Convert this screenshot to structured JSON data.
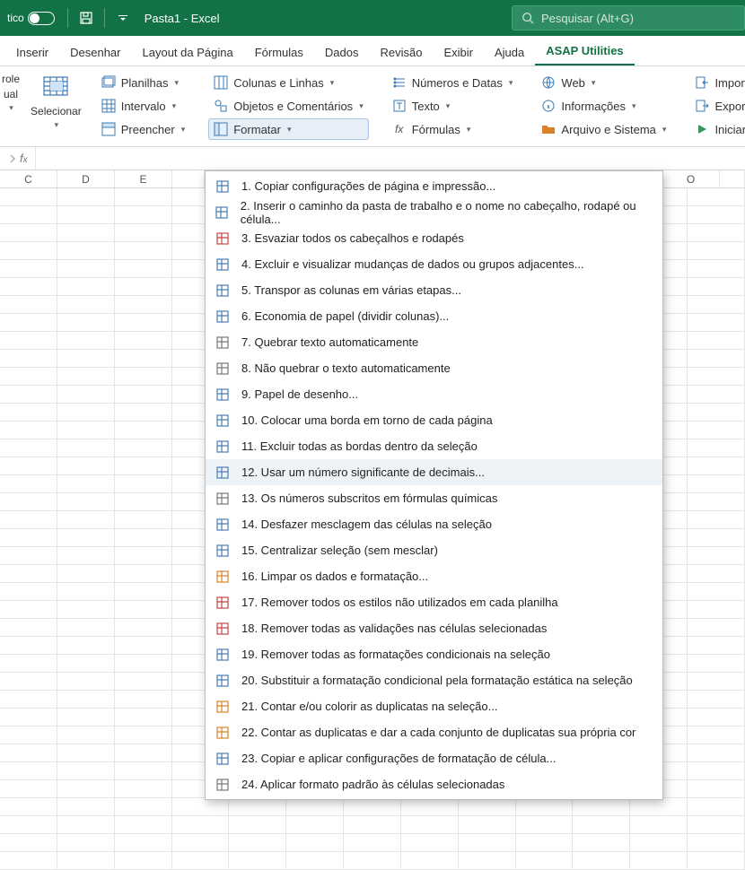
{
  "titlebar": {
    "autosave_label": "tico",
    "title": "Pasta1  -  Excel",
    "search_placeholder": "Pesquisar (Alt+G)"
  },
  "tabs": [
    "Inserir",
    "Desenhar",
    "Layout da Página",
    "Fórmulas",
    "Dados",
    "Revisão",
    "Exibir",
    "Ajuda",
    "ASAP Utilities"
  ],
  "ribbon": {
    "big1_line1": "role",
    "big1_line2": "ual",
    "big2": "Selecionar",
    "group1": [
      "Planilhas",
      "Intervalo",
      "Preencher"
    ],
    "group2": [
      "Colunas e Linhas",
      "Objetos e Comentários",
      "Formatar"
    ],
    "group3": [
      "Números e Datas",
      "Texto",
      "Fórmulas"
    ],
    "group4": [
      "Web",
      "Informações",
      "Arquivo e Sistema"
    ],
    "group5": [
      "Importar",
      "Exportar",
      "Iniciar"
    ]
  },
  "columns": [
    "C",
    "D",
    "E",
    "",
    "",
    "",
    "",
    "",
    "",
    "O"
  ],
  "menu": [
    "1. Copiar configurações de página e impressão...",
    "2. Inserir o caminho da pasta de trabalho e o nome no cabeçalho, rodapé ou célula...",
    "3. Esvaziar todos os cabeçalhos e rodapés",
    "4. Excluir e visualizar mudanças de dados ou grupos adjacentes...",
    "5. Transpor as colunas em várias etapas...",
    "6. Economia de papel (dividir colunas)...",
    "7. Quebrar texto automaticamente",
    "8. Não quebrar o texto automaticamente",
    "9. Papel de desenho...",
    "10. Colocar uma borda em torno de cada página",
    "11. Excluir todas as bordas dentro da seleção",
    "12. Usar um número significante de decimais...",
    "13. Os números subscritos em fórmulas químicas",
    "14. Desfazer mesclagem das células na seleção",
    "15. Centralizar seleção (sem mesclar)",
    "16. Limpar os dados e formatação...",
    "17. Remover todos os estilos não utilizados em cada planilha",
    "18. Remover todas as validações nas células selecionadas",
    "19. Remover todas as formatações condicionais na seleção",
    "20. Substituir a formatação condicional pela formatação estática na seleção",
    "21. Contar e/ou colorir as duplicatas na seleção...",
    "22. Contar as duplicatas e dar a cada conjunto de duplicatas sua própria cor",
    "23. Copiar e aplicar configurações de formatação de célula...",
    "24. Aplicar formato padrão às células selecionadas"
  ],
  "menu_highlight": 11
}
